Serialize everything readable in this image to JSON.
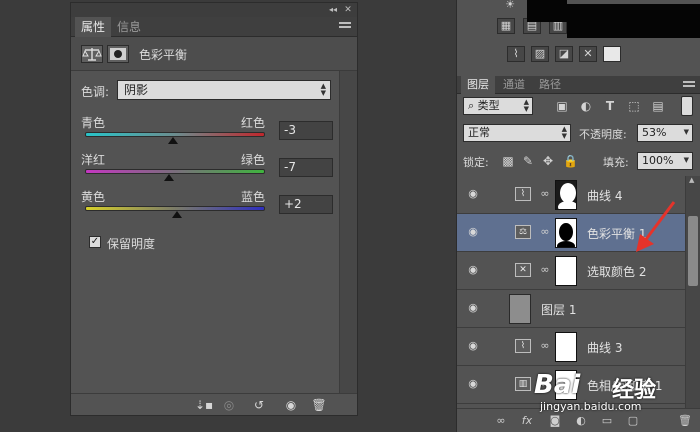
{
  "properties_panel": {
    "tabs": [
      {
        "label": "属性",
        "active": true
      },
      {
        "label": "信息",
        "active": false
      }
    ],
    "header_title": "色彩平衡",
    "tone_label": "色调:",
    "tone_value": "阴影",
    "sliders": [
      {
        "left": "青色",
        "right": "红色",
        "value": "-3",
        "fraction": 0.49
      },
      {
        "left": "洋红",
        "right": "绿色",
        "value": "-7",
        "fraction": 0.465
      },
      {
        "left": "黄色",
        "right": "蓝色",
        "value": "+2",
        "fraction": 0.51
      }
    ],
    "preserve_luminosity_label": "保留明度",
    "preserve_luminosity_checked": true
  },
  "layers_panel": {
    "tabs": [
      {
        "label": "图层",
        "active": true
      },
      {
        "label": "通道",
        "active": false
      },
      {
        "label": "路径",
        "active": false
      }
    ],
    "filter_kind": "类型",
    "blend_mode": "正常",
    "opacity_label": "不透明度:",
    "opacity_value": "53%",
    "lock_label": "锁定:",
    "fill_label": "填充:",
    "fill_value": "100%",
    "layers": [
      {
        "name": "曲线 4",
        "type": "curves",
        "selected": false
      },
      {
        "name": "色彩平衡 1",
        "type": "color-balance",
        "selected": true
      },
      {
        "name": "选取颜色 2",
        "type": "selective-color",
        "selected": false
      },
      {
        "name": "图层 1",
        "type": "pixel",
        "selected": false
      },
      {
        "name": "曲线 3",
        "type": "curves",
        "selected": false
      },
      {
        "name": "色相/饱和度 1",
        "type": "hue-saturation",
        "selected": false
      }
    ]
  },
  "watermark": {
    "brand": "Bai",
    "brand2": "经验",
    "url": "jingyan.baidu.com"
  },
  "colors": {
    "panel": "#535353",
    "selected_layer": "#5f7090",
    "annotation_arrow": "#e5332a"
  }
}
